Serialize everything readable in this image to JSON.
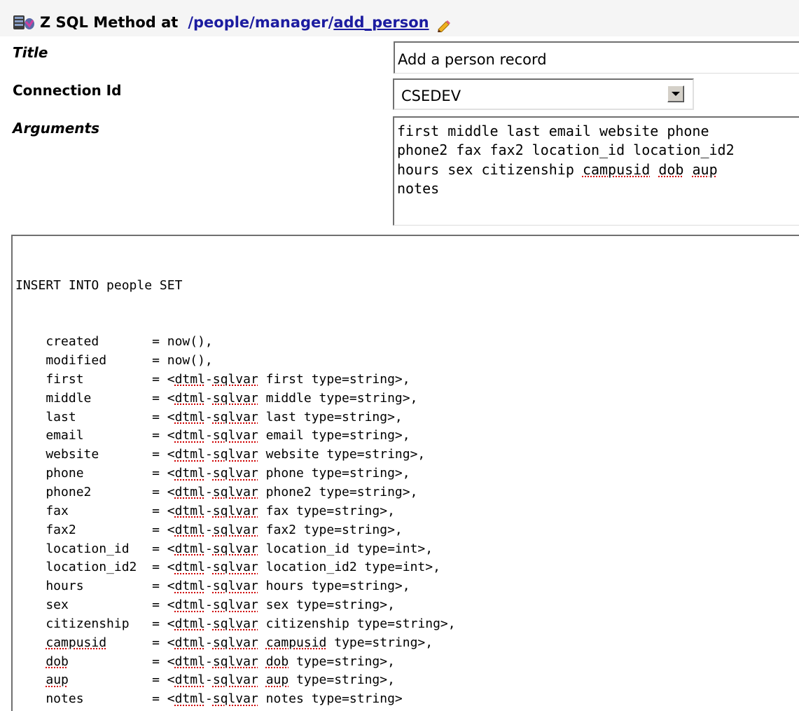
{
  "header": {
    "meta_type": "Z SQL Method at",
    "path_prefix": "/people/manager/",
    "path_link": "add_person",
    "icons": {
      "object": "database-icon",
      "edit": "pencil-icon"
    }
  },
  "form": {
    "title_label": "Title",
    "title_value": "Add a person record",
    "connection_label": "Connection Id",
    "connection_value": "CSEDEV",
    "arguments_label": "Arguments",
    "arguments_lines": [
      "first middle last email website phone",
      "phone2 fax fax2 location_id location_id2",
      "hours sex citizenship campusid dob aup",
      "notes"
    ]
  },
  "sql": {
    "first_line": "INSERT INTO people SET",
    "prefix": "<",
    "tag_a": "dtml",
    "dash": "-",
    "tag_b": "sqlvar",
    "rows": [
      {
        "col": "    created       ",
        "rest": "= now(),",
        "dtml": false
      },
      {
        "col": "    modified      ",
        "rest": "= now(),",
        "dtml": false
      },
      {
        "col": "    first         ",
        "var": "first",
        "type": " type=string>,",
        "dtml": true
      },
      {
        "col": "    middle        ",
        "var": "middle",
        "type": " type=string>,",
        "dtml": true
      },
      {
        "col": "    last          ",
        "var": "last",
        "type": " type=string>,",
        "dtml": true
      },
      {
        "col": "    email         ",
        "var": "email",
        "type": " type=string>,",
        "dtml": true
      },
      {
        "col": "    website       ",
        "var": "website",
        "type": " type=string>,",
        "dtml": true
      },
      {
        "col": "    phone         ",
        "var": "phone",
        "type": " type=string>,",
        "dtml": true
      },
      {
        "col": "    phone2        ",
        "var": "phone2",
        "type": " type=string>,",
        "dtml": true
      },
      {
        "col": "    fax           ",
        "var": "fax",
        "type": " type=string>,",
        "dtml": true
      },
      {
        "col": "    fax2          ",
        "var": "fax2",
        "type": " type=string>,",
        "dtml": true
      },
      {
        "col": "    location_id   ",
        "var": "location_id",
        "type": " type=int>,",
        "dtml": true
      },
      {
        "col": "    location_id2  ",
        "var": "location_id2",
        "type": " type=int>,",
        "dtml": true
      },
      {
        "col": "    hours         ",
        "var": "hours",
        "type": " type=string>,",
        "dtml": true
      },
      {
        "col": "    sex           ",
        "var": "sex",
        "type": " type=string>,",
        "dtml": true
      },
      {
        "col": "    citizenship   ",
        "var": "citizenship",
        "type": " type=string>,",
        "dtml": true
      },
      {
        "col": "    campusid      ",
        "var": "campusid",
        "type": " type=string>,",
        "dtml": true,
        "misspelled": true
      },
      {
        "col": "    dob           ",
        "var": "dob",
        "type": " type=string>,",
        "dtml": true,
        "misspelled": true
      },
      {
        "col": "    aup           ",
        "var": "aup",
        "type": " type=string>,",
        "dtml": true,
        "misspelled": true
      },
      {
        "col": "    notes         ",
        "var": "notes",
        "type": " type=string>",
        "dtml": true
      }
    ]
  }
}
